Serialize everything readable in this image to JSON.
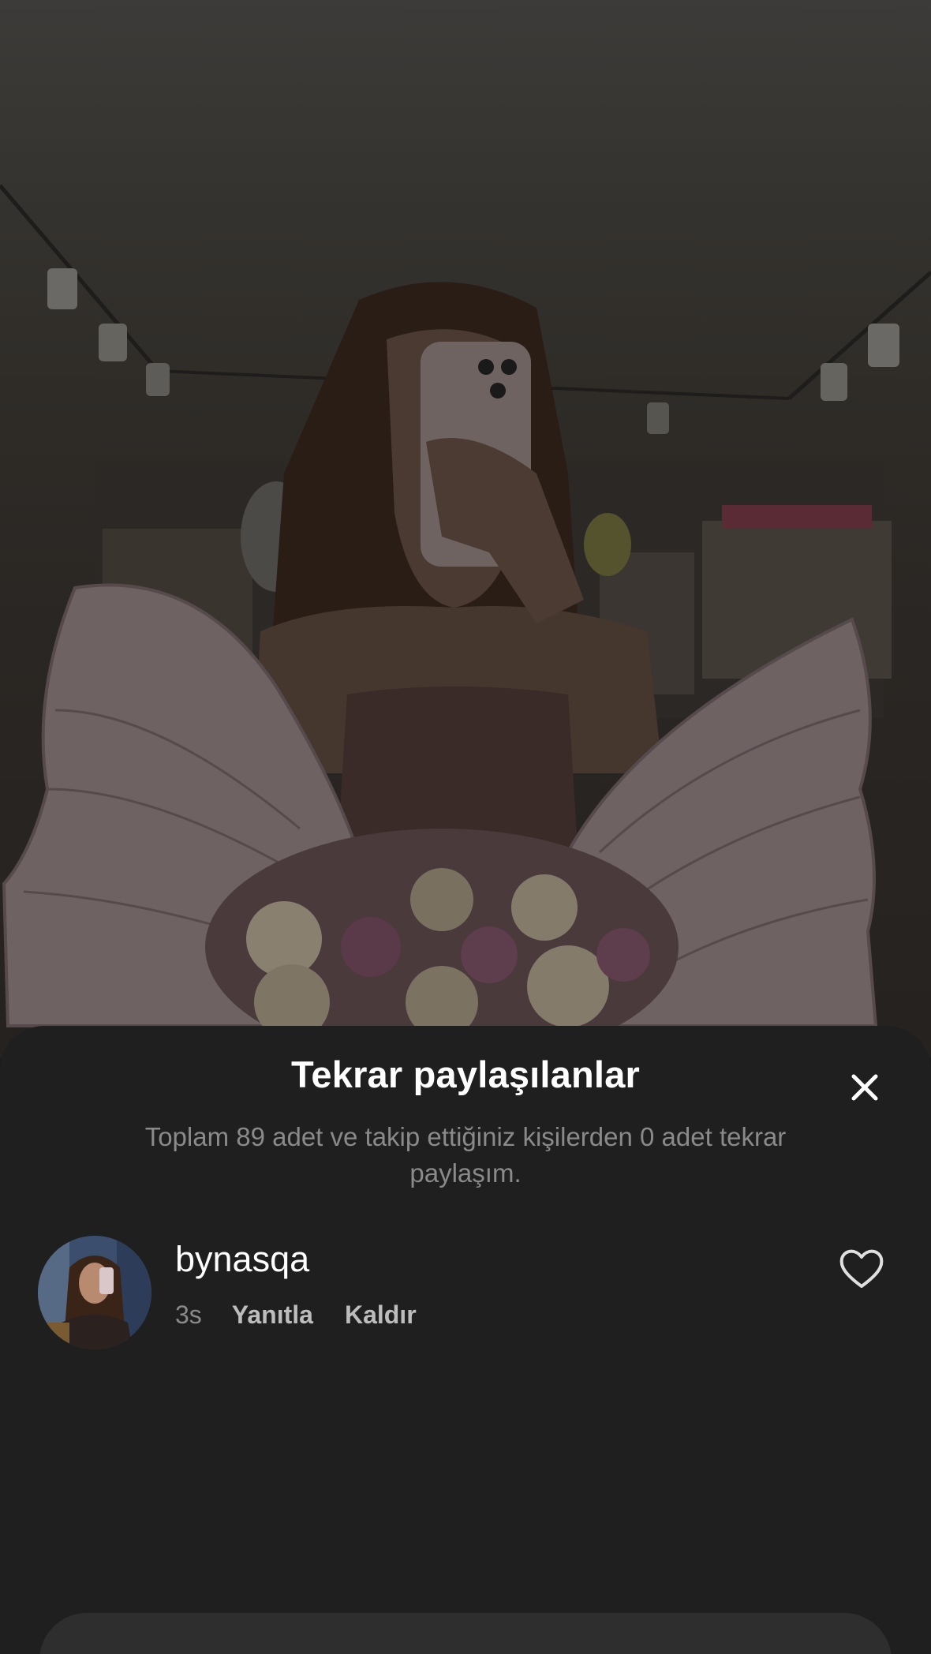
{
  "sheet": {
    "title": "Tekrar paylaşılanlar",
    "subtitle": "Toplam 89 adet ve takip ettiğiniz kişilerden 0 adet tekrar paylaşım."
  },
  "reposts": [
    {
      "username": "bynasqa",
      "time": "3s",
      "reply_label": "Yanıtla",
      "remove_label": "Kaldır"
    }
  ],
  "icons": {
    "close": "close-icon",
    "like": "heart-icon"
  },
  "colors": {
    "sheet_background": "#1f1f1f",
    "title": "#ffffff",
    "secondary_text": "#8a8a8a",
    "action_text": "#bdbdbd"
  }
}
